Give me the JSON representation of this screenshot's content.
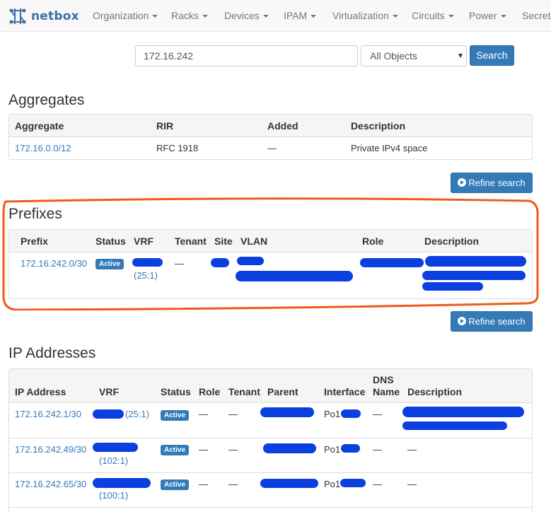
{
  "nav": {
    "brand": "netbox",
    "items": [
      "Organization",
      "Racks",
      "Devices",
      "IPAM",
      "Virtualization",
      "Circuits",
      "Power",
      "Secrets"
    ]
  },
  "search": {
    "query": "172.16.242",
    "scope": "All Objects",
    "button": "Search"
  },
  "aggregates": {
    "title": "Aggregates",
    "columns": [
      "Aggregate",
      "RIR",
      "Added",
      "Description"
    ],
    "rows": [
      {
        "aggregate": "172.16.0.0/12",
        "rir": "RFC 1918",
        "added": "—",
        "description": "Private IPv4 space"
      }
    ],
    "refine": "Refine search"
  },
  "prefixes": {
    "title": "Prefixes",
    "columns": [
      "Prefix",
      "Status",
      "VRF",
      "Tenant",
      "Site",
      "VLAN",
      "Role",
      "Description"
    ],
    "rows": [
      {
        "prefix": "172.16.242.0/30",
        "status": "Active",
        "vrf_rd": "(25:1)",
        "tenant": "—"
      }
    ],
    "refine": "Refine search"
  },
  "ip_addresses": {
    "title": "IP Addresses",
    "columns": [
      "IP Address",
      "VRF",
      "Status",
      "Role",
      "Tenant",
      "Parent",
      "Interface",
      "DNS",
      "Name",
      "Description"
    ],
    "rows": [
      {
        "address": "172.16.242.1/30",
        "vrf_rd": "(25:1)",
        "status": "Active",
        "role": "—",
        "tenant": "—",
        "interface": "Po1",
        "dns": "—",
        "description": ""
      },
      {
        "address": "172.16.242.49/30",
        "vrf_rd": "(102:1)",
        "status": "Active",
        "role": "—",
        "tenant": "—",
        "interface": "Po1",
        "dns": "—",
        "description": "—"
      },
      {
        "address": "172.16.242.65/30",
        "vrf_rd": "(100:1)",
        "status": "Active",
        "role": "—",
        "tenant": "—",
        "interface": "Po1",
        "dns": "—",
        "description": "—"
      }
    ]
  },
  "colors": {
    "primary": "#337ab7",
    "redaction": "#0a3fe0",
    "highlight": "#f05a1a"
  }
}
